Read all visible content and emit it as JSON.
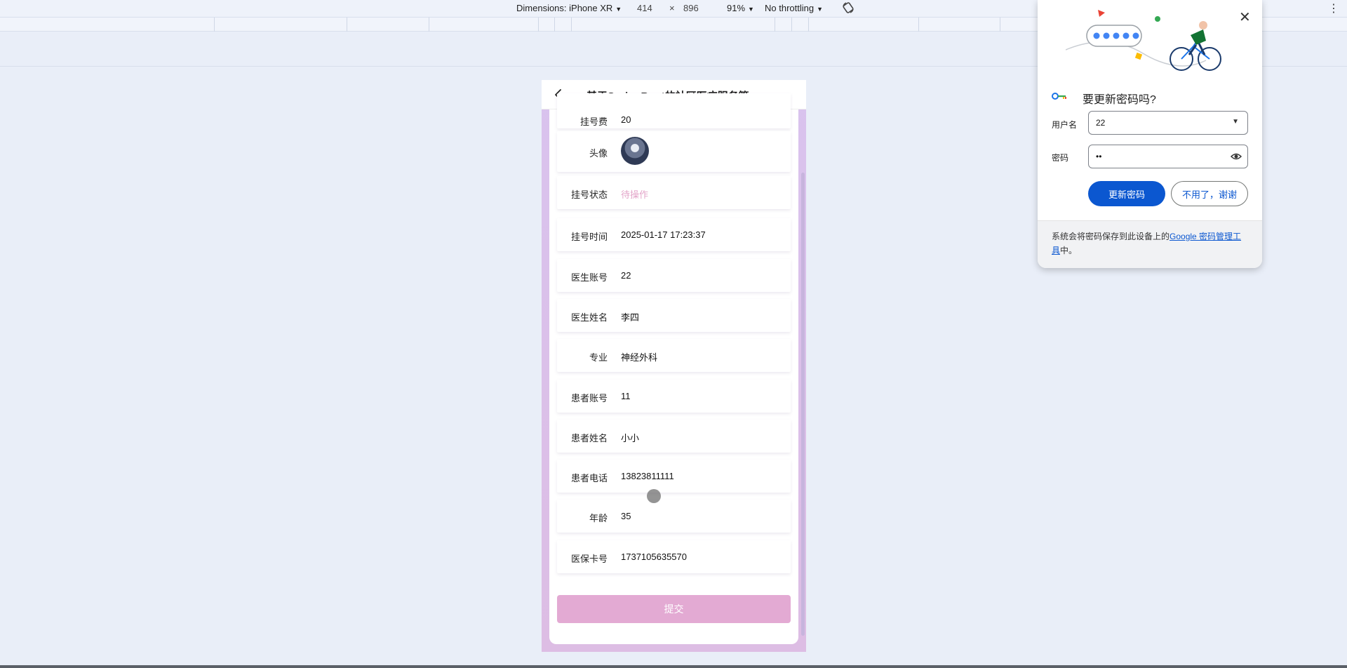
{
  "devtools": {
    "dimensions_label": "Dimensions: iPhone XR",
    "width": "414",
    "times": "×",
    "height": "896",
    "zoom": "91%",
    "throttling": "No throttling"
  },
  "app": {
    "title": "基于SpringBoot的社区医疗服务管...",
    "fields": [
      {
        "label": "挂号费",
        "value": "20"
      },
      {
        "label": "头像",
        "value": ""
      },
      {
        "label": "挂号状态",
        "value": "待操作"
      },
      {
        "label": "挂号时间",
        "value": "2025-01-17 17:23:37"
      },
      {
        "label": "医生账号",
        "value": "22"
      },
      {
        "label": "医生姓名",
        "value": "李四"
      },
      {
        "label": "专业",
        "value": "神经外科"
      },
      {
        "label": "患者账号",
        "value": "11"
      },
      {
        "label": "患者姓名",
        "value": "小小"
      },
      {
        "label": "患者电话",
        "value": "13823811111"
      },
      {
        "label": "年龄",
        "value": "35"
      },
      {
        "label": "医保卡号",
        "value": "1737105635570"
      }
    ],
    "submit_label": "提交"
  },
  "password_popup": {
    "title": "要更新密码吗?",
    "username_label": "用户名",
    "username_value": "22",
    "password_label": "密码",
    "password_value": "••",
    "update_button": "更新密码",
    "dismiss_button": "不用了，谢谢",
    "footer_text": "系统会将密码保存到此设备上的",
    "footer_link": "Google 密码管理工具",
    "footer_suffix": "中。"
  },
  "colors": {
    "accent": "#0b57d0",
    "submit": "#e3aad3",
    "placeholder": "#e3a5c9"
  }
}
